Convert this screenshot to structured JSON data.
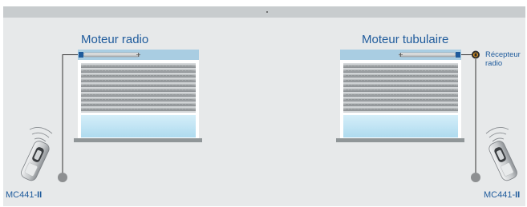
{
  "left": {
    "title": "Moteur radio",
    "remote_model": "MC441-",
    "remote_suffix": "II"
  },
  "right": {
    "title": "Moteur tubulaire",
    "receiver_label_line1": "Récepteur",
    "receiver_label_line2": "radio",
    "remote_model": "MC441-",
    "remote_suffix": "II"
  },
  "colors": {
    "background_panel": "#e7e9ea",
    "top_band": "#c8ccce",
    "title_blue": "#1f5b9c",
    "motor_band": "#a9cde2",
    "shutter_slat": "#a7abad",
    "window_glass": "#bfe3f3",
    "sill": "#909698",
    "cable": "#333333",
    "cable_end": "#8d8f91"
  }
}
